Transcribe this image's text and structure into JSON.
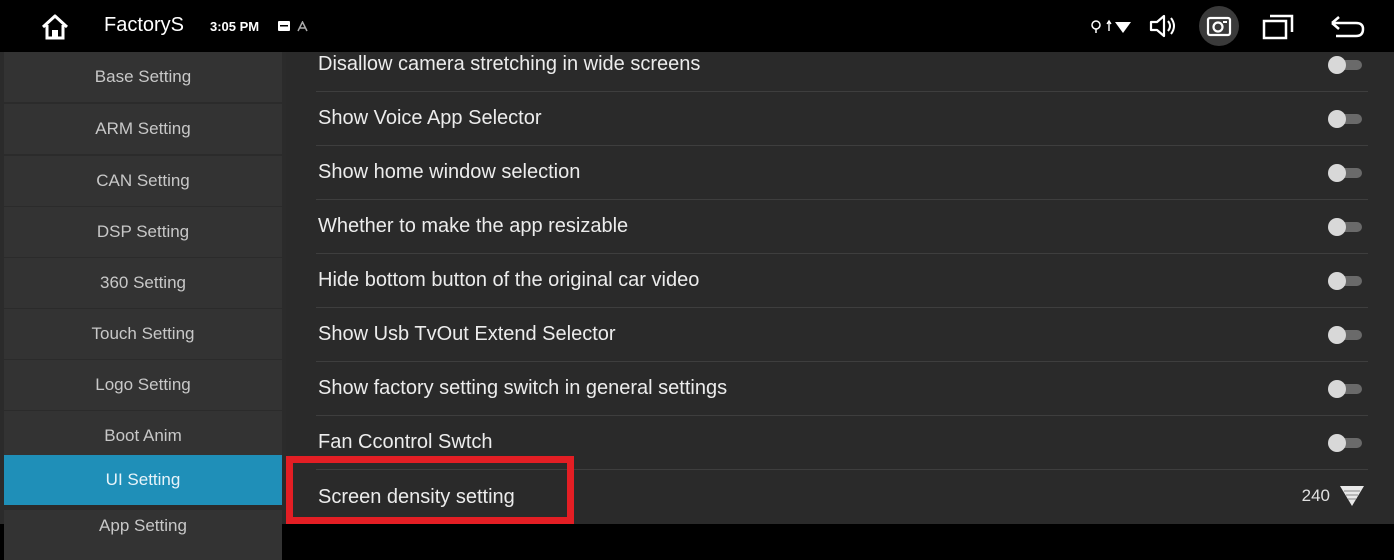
{
  "statusbar": {
    "title": "FactoryS",
    "time": "3:05 PM",
    "icons": [
      "home-icon",
      "notification-icon",
      "a-icon",
      "location-icon",
      "signal-wifi-icon",
      "volume-icon",
      "camera-icon",
      "recent-apps-icon",
      "back-icon"
    ]
  },
  "sidebar": {
    "items": [
      {
        "label": "Base Setting"
      },
      {
        "label": "ARM Setting"
      },
      {
        "label": "CAN Setting"
      },
      {
        "label": "DSP Setting"
      },
      {
        "label": "360 Setting"
      },
      {
        "label": "Touch Setting"
      },
      {
        "label": "Logo Setting"
      },
      {
        "label": "Boot Anim"
      },
      {
        "label": "UI Setting"
      },
      {
        "label": "App Setting"
      }
    ],
    "active": "UI Setting"
  },
  "main": {
    "rows": [
      {
        "label": "Disallow camera stretching in wide screens",
        "enabled": false
      },
      {
        "label": "Show Voice App Selector",
        "enabled": false
      },
      {
        "label": "Show home window selection",
        "enabled": false
      },
      {
        "label": "Whether to make the app resizable",
        "enabled": false
      },
      {
        "label": "Hide bottom button of the original car video",
        "enabled": false
      },
      {
        "label": "Show Usb TvOut Extend Selector",
        "enabled": false
      },
      {
        "label": "Show factory setting switch in general settings",
        "enabled": false
      },
      {
        "label": "Fan Ccontrol Swtch",
        "enabled": false
      }
    ],
    "density": {
      "label": "Screen density setting",
      "value": "240"
    }
  },
  "colors": {
    "accent": "#1f8fb8",
    "highlight": "#e31e24",
    "background": "#2a2a2a"
  }
}
